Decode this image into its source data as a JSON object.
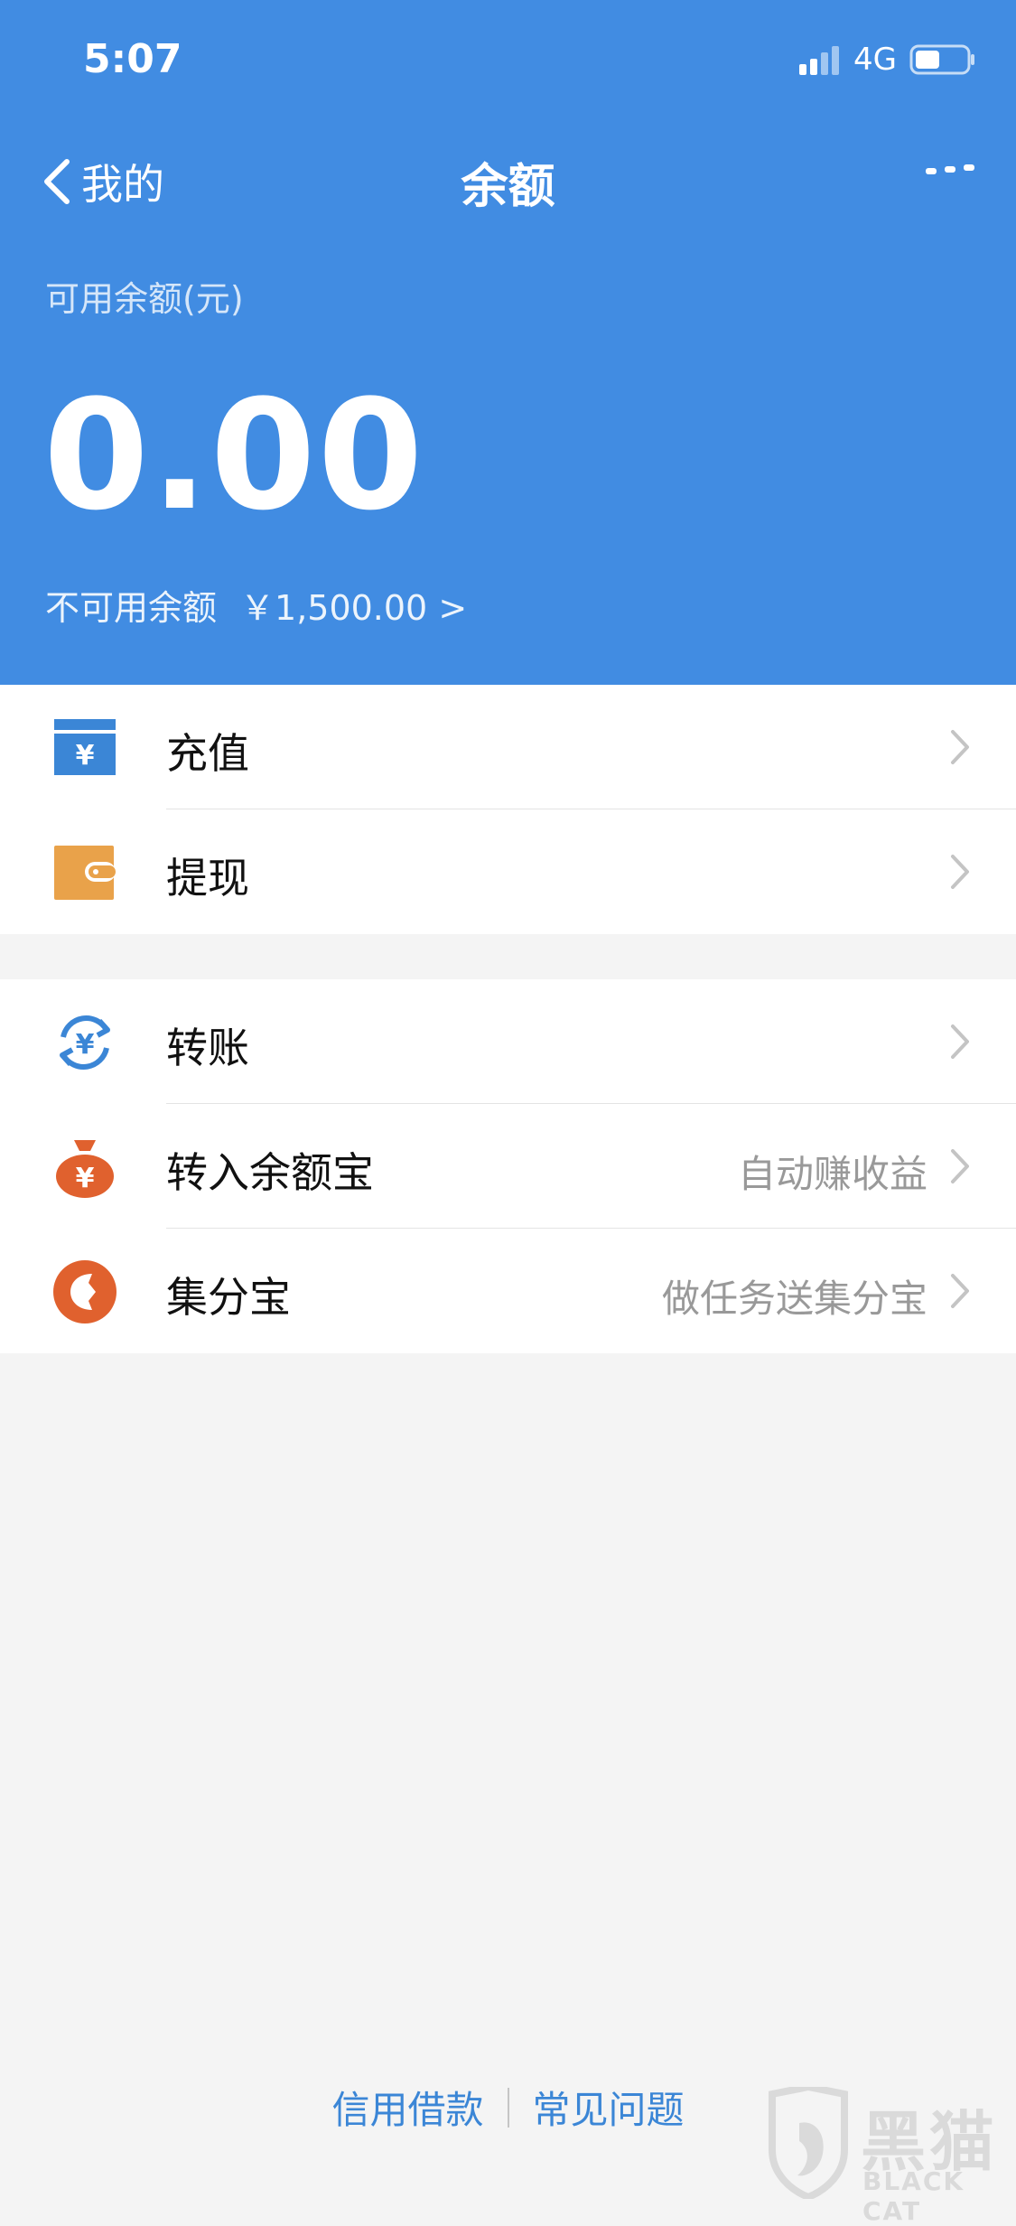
{
  "status_bar": {
    "time": "5:07",
    "network": "4G"
  },
  "nav": {
    "back_label": "我的",
    "title": "余额"
  },
  "balance": {
    "available_label": "可用余额(元)",
    "available_value": "0.00",
    "unavailable_label": "不可用余额",
    "unavailable_value": "￥1,500.00 >"
  },
  "group1": [
    {
      "label": "充值",
      "icon": "recharge-icon"
    },
    {
      "label": "提现",
      "icon": "wallet-icon"
    }
  ],
  "group2": [
    {
      "label": "转账",
      "icon": "transfer-icon",
      "hint": ""
    },
    {
      "label": "转入余额宝",
      "icon": "money-bag-icon",
      "hint": "自动赚收益"
    },
    {
      "label": "集分宝",
      "icon": "points-icon",
      "hint": "做任务送集分宝"
    }
  ],
  "footer": {
    "link1": "信用借款",
    "link2": "常见问题"
  },
  "watermark": {
    "cn": "黑猫",
    "en": "BLACK CAT"
  },
  "colors": {
    "header_bg": "#418ce2",
    "link": "#3b86d6",
    "orange": "#e0612e",
    "gold": "#e9a24a"
  }
}
